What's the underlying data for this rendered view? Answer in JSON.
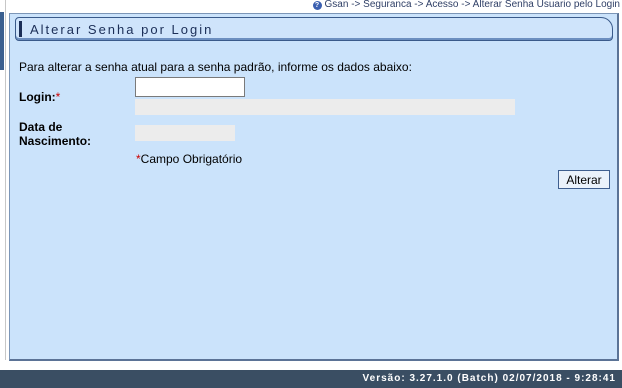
{
  "breadcrumb": {
    "icon": "help-icon",
    "text": "Gsan -> Seguranca -> Acesso -> Alterar Senha Usuario pelo Login"
  },
  "panel": {
    "title": "Alterar Senha por Login",
    "instructions": "Para alterar a senha atual para a senha padrão, informe os dados abaixo:"
  },
  "form": {
    "login_label": "Login:",
    "required_mark": "*",
    "login_value": "",
    "birth_label_line1": "Data de",
    "birth_label_line2": "Nascimento:",
    "required_note_mark": "*",
    "required_note": "Campo Obrigatório",
    "submit_label": "Alterar"
  },
  "footer": {
    "version": "Versão: 3.27.1.0 (Batch) 02/07/2018 - 9:28:41"
  },
  "colors": {
    "panel_bg": "#cbe3fb",
    "footer_bg": "#3a4e63",
    "required": "#cc0000"
  }
}
